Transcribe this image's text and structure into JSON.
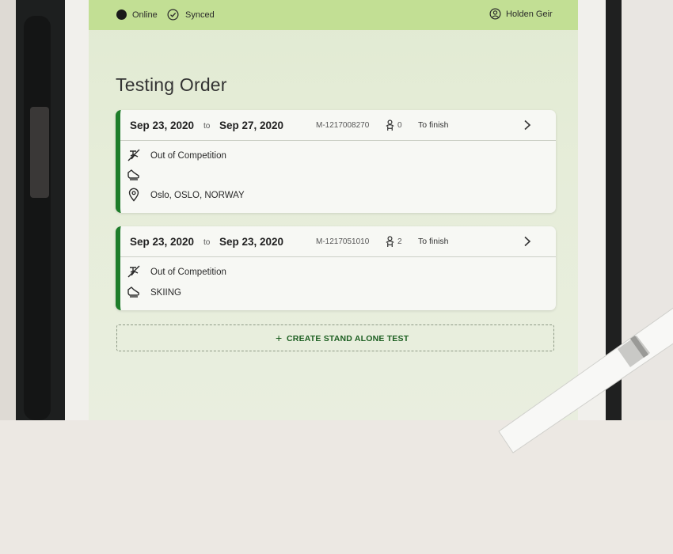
{
  "header": {
    "online_label": "Online",
    "synced_label": "Synced",
    "user_name": "Holden Geir"
  },
  "page": {
    "title": "Testing Order"
  },
  "orders": [
    {
      "date_from": "Sep 23, 2020",
      "to_label": "to",
      "date_to": "Sep 27, 2020",
      "order_id": "M-1217008270",
      "athlete_count": "0",
      "status": "To finish",
      "competition": "Out of Competition",
      "sport": "",
      "location": "Oslo, OSLO, NORWAY"
    },
    {
      "date_from": "Sep 23, 2020",
      "to_label": "to",
      "date_to": "Sep 23, 2020",
      "order_id": "M-1217051010",
      "athlete_count": "2",
      "status": "To finish",
      "competition": "Out of Competition",
      "sport": "SKIING"
    }
  ],
  "actions": {
    "create_standalone": "CREATE STAND ALONE TEST"
  },
  "colors": {
    "accent": "#1e7d2a",
    "topbar": "#c2df94",
    "action_text": "#1b5e20"
  },
  "icons": {
    "online": "status-dot-icon",
    "synced": "check-circle-icon",
    "user": "user-circle-icon",
    "athletes": "athlete-icon",
    "competition": "no-competition-icon",
    "sport": "shoe-icon",
    "location": "location-pin-icon",
    "open": "chevron-right-icon",
    "add": "plus-icon"
  }
}
